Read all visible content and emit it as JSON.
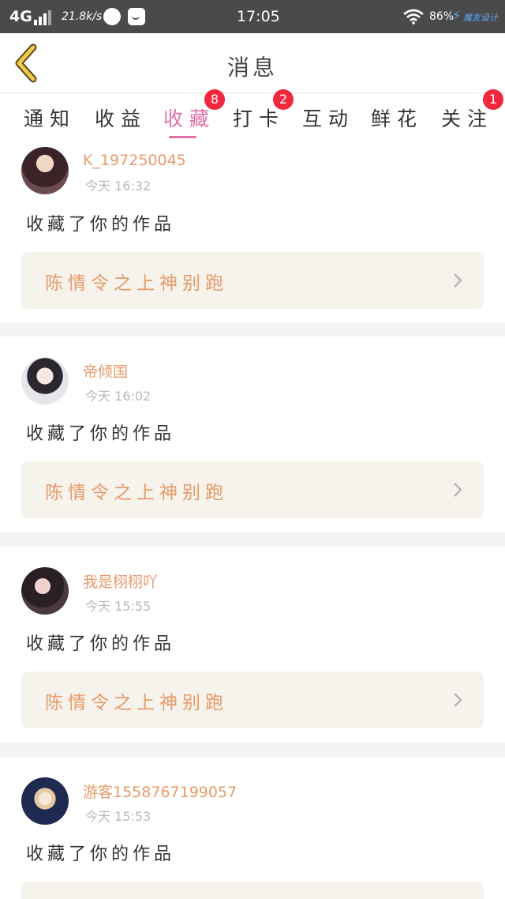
{
  "status_bar": {
    "network": "4G",
    "speed": "21.8k/s",
    "time": "17:05",
    "battery": "86%",
    "brand": "魔友设计"
  },
  "header": {
    "title": "消息"
  },
  "tabs": [
    {
      "label": "通知",
      "badge": ""
    },
    {
      "label": "收益",
      "badge": ""
    },
    {
      "label": "收藏",
      "badge": "8",
      "active": true
    },
    {
      "label": "打卡",
      "badge": "2"
    },
    {
      "label": "互动",
      "badge": ""
    },
    {
      "label": "鲜花",
      "badge": ""
    },
    {
      "label": "关注",
      "badge": "1"
    }
  ],
  "messages": [
    {
      "user": "K_197250045",
      "time": "今天 16:32",
      "text": "收藏了你的作品",
      "work": "陈情令之上神别跑"
    },
    {
      "user": "帝倾国",
      "time": "今天 16:02",
      "text": "收藏了你的作品",
      "work": "陈情令之上神别跑"
    },
    {
      "user": "我是栩栩吖",
      "time": "今天 15:55",
      "text": "收藏了你的作品",
      "work": "陈情令之上神别跑"
    },
    {
      "user": "游客1558767199057",
      "time": "今天 15:53",
      "text": "收藏了你的作品",
      "work": ""
    }
  ],
  "colors": {
    "accent": "#e070a8",
    "badge": "#f0283d",
    "username": "#e89a6a",
    "card_bg": "#f5f3ec",
    "back_arrow": "#f2c94c"
  },
  "icons": {
    "back": "chevron-left-icon",
    "arrow": "chevron-right-icon",
    "wifi": "wifi-icon",
    "signal": "signal-icon",
    "charging": "lightning-icon"
  }
}
